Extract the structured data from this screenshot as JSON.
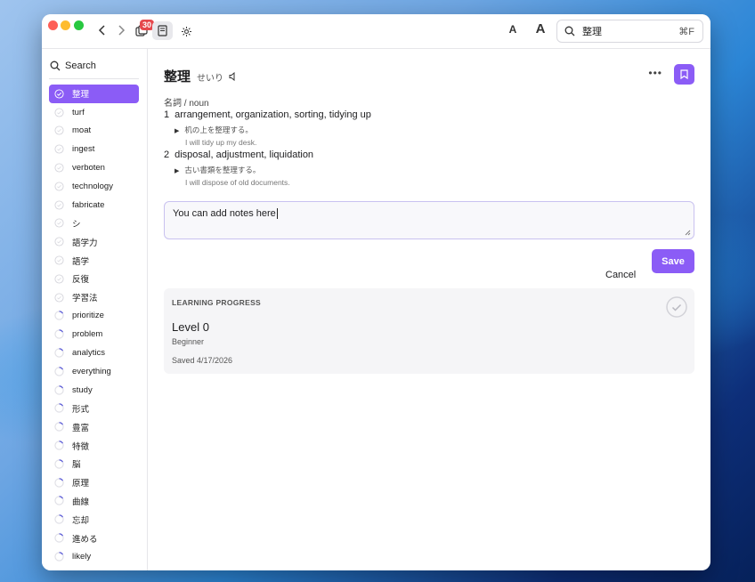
{
  "toolbar": {
    "badge_count": "30",
    "font_small_label": "A",
    "font_large_label": "A",
    "search_value": "整理",
    "search_shortcut": "⌘F"
  },
  "sidebar": {
    "search_label": "Search",
    "items": [
      {
        "label": "整理",
        "status": "active"
      },
      {
        "label": "turf",
        "status": "empty"
      },
      {
        "label": "moat",
        "status": "empty"
      },
      {
        "label": "ingest",
        "status": "empty"
      },
      {
        "label": "verboten",
        "status": "empty"
      },
      {
        "label": "technology",
        "status": "empty"
      },
      {
        "label": "fabricate",
        "status": "empty"
      },
      {
        "label": "シ",
        "status": "empty"
      },
      {
        "label": "語学力",
        "status": "empty"
      },
      {
        "label": "語学",
        "status": "empty"
      },
      {
        "label": "反復",
        "status": "empty"
      },
      {
        "label": "学習法",
        "status": "empty"
      },
      {
        "label": "prioritize",
        "status": "learning"
      },
      {
        "label": "problem",
        "status": "learning"
      },
      {
        "label": "analytics",
        "status": "learning"
      },
      {
        "label": "everything",
        "status": "learning"
      },
      {
        "label": "study",
        "status": "learning"
      },
      {
        "label": "形式",
        "status": "learning"
      },
      {
        "label": "豊富",
        "status": "learning"
      },
      {
        "label": "特徴",
        "status": "learning"
      },
      {
        "label": "脳",
        "status": "learning"
      },
      {
        "label": "原理",
        "status": "learning"
      },
      {
        "label": "曲線",
        "status": "learning"
      },
      {
        "label": "忘却",
        "status": "learning"
      },
      {
        "label": "進める",
        "status": "learning"
      },
      {
        "label": "likely",
        "status": "learning"
      }
    ]
  },
  "entry": {
    "word": "整理",
    "reading": "せいり",
    "part_of_speech": "名詞 / noun",
    "senses": [
      {
        "num": "1",
        "definition": "arrangement, organization, sorting, tidying up",
        "example_ja": "机の上を整理する。",
        "example_en": "I will tidy up my desk."
      },
      {
        "num": "2",
        "definition": "disposal, adjustment, liquidation",
        "example_ja": "古い書類を整理する。",
        "example_en": "I will dispose of old documents."
      }
    ]
  },
  "notes": {
    "value": "You can add notes here",
    "cancel_label": "Cancel",
    "save_label": "Save"
  },
  "progress": {
    "title": "LEARNING PROGRESS",
    "level": "Level 0",
    "level_name": "Beginner",
    "saved": "Saved 4/17/2026"
  },
  "colors": {
    "accent": "#8b5cf6",
    "badge": "#e5484d"
  }
}
